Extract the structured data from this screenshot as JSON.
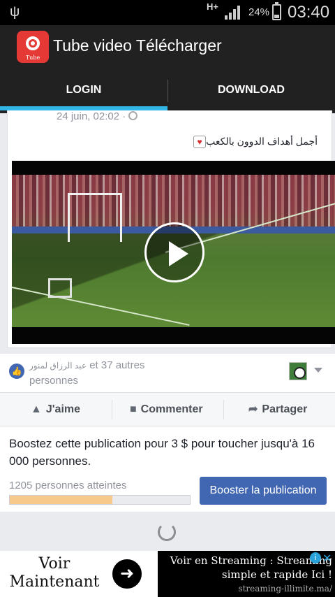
{
  "status_bar": {
    "usb_icon": "usb-icon",
    "network": "H+",
    "battery_percent": "24%",
    "time": "03:40"
  },
  "app": {
    "title": "Tube video Télécharger",
    "logo_text": "Tube"
  },
  "tabs": [
    {
      "label": "LOGIN",
      "selected": true
    },
    {
      "label": "DOWNLOAD",
      "selected": false
    }
  ],
  "post": {
    "timestamp": "24 juin, 02:02 ·",
    "text": "أجمل أهداف الدوون بالكعب",
    "video_watermark": "",
    "reactions": {
      "arabic_name": "عبد الرزاق لمنور",
      "summary": "et 37 autres personnes"
    },
    "actions": {
      "like": "J'aime",
      "comment": "Commenter",
      "share": "Partager"
    },
    "boost": {
      "message": "Boostez cette publication pour 3 $ pour toucher jusqu'à 16 000 personnes.",
      "reached": "1205 personnes atteintes",
      "progress_percent": 57,
      "button": "Booster la publication"
    }
  },
  "ad": {
    "left_text": "Voir Maintenant",
    "right_line1": "Voir en Streaming : Streaming",
    "right_line2": "simple et rapide Ici !",
    "right_url": "streaming-illimite.ma/",
    "info": "i",
    "close": "✕"
  },
  "colors": {
    "accent_tab": "#33b5e5",
    "facebook_blue": "#4267b2",
    "app_red": "#e53935"
  }
}
